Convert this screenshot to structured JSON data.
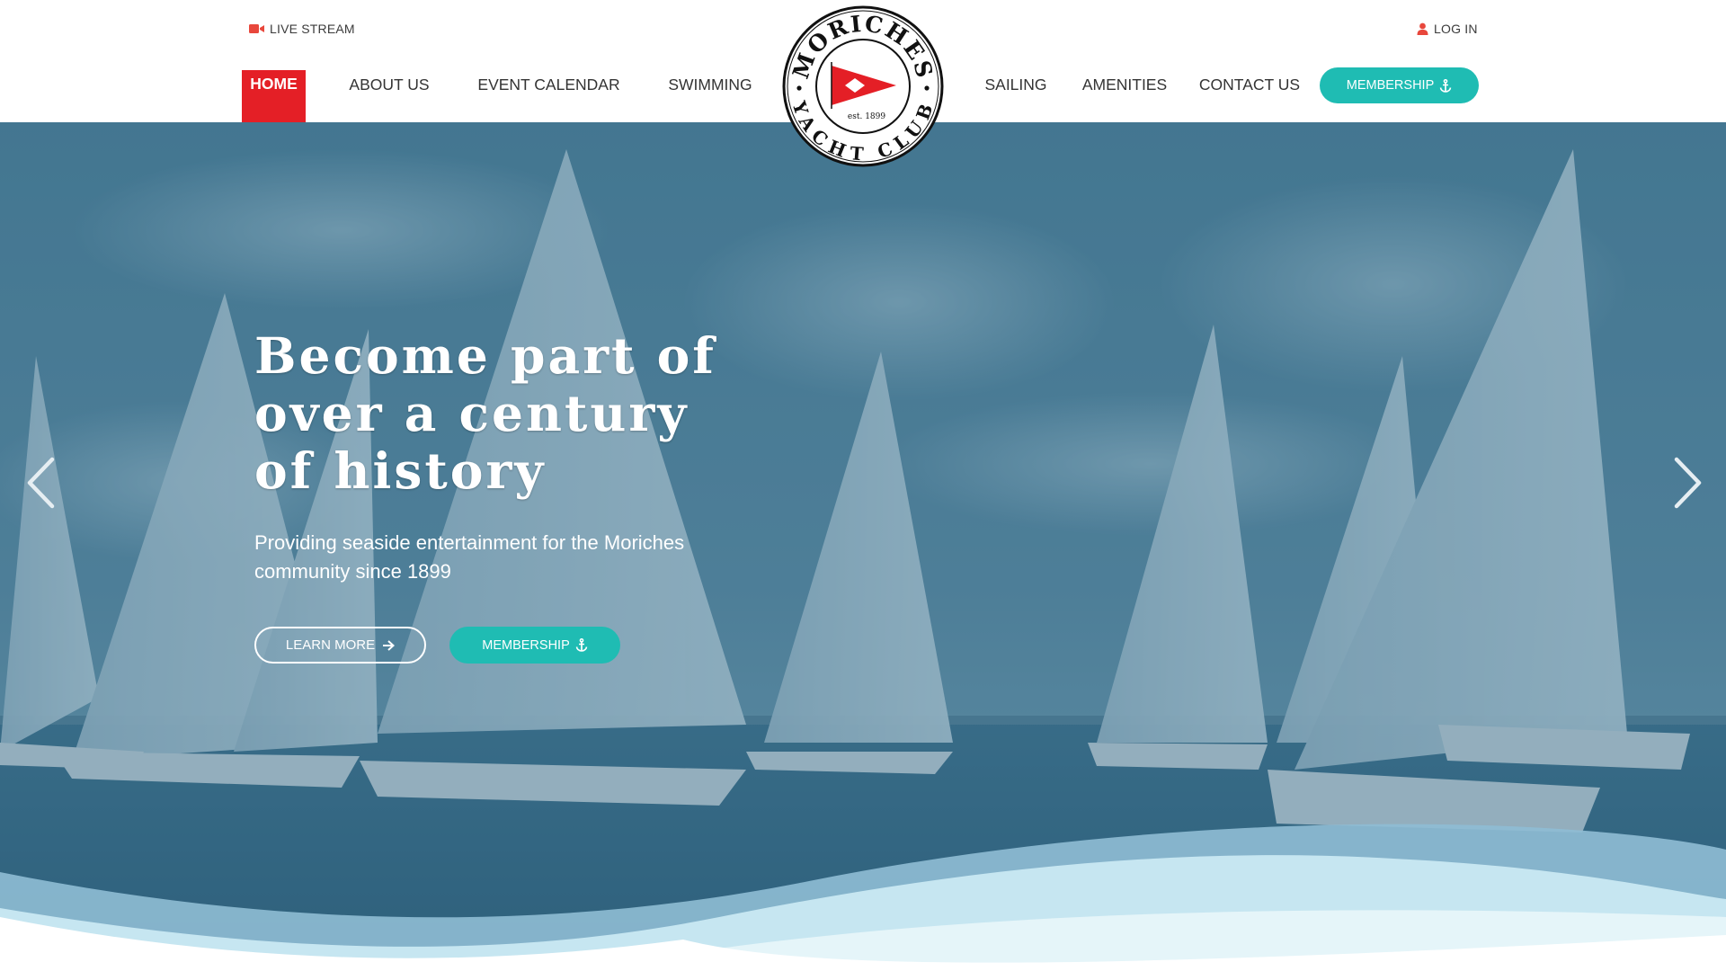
{
  "header": {
    "live_stream": {
      "label": "LIVE STREAM",
      "icon": "video-camera-icon",
      "icon_color": "#e8473c"
    },
    "log_in": {
      "label": "LOG IN",
      "icon": "user-icon",
      "icon_color": "#e8473c"
    },
    "nav": [
      {
        "label": "HOME",
        "active": true
      },
      {
        "label": "ABOUT US"
      },
      {
        "label": "EVENT CALENDAR"
      },
      {
        "label": "SWIMMING"
      },
      {
        "label": "SAILING"
      },
      {
        "label": "AMENITIES"
      },
      {
        "label": "CONTACT US"
      }
    ],
    "membership_button": {
      "label": "MEMBERSHIP",
      "icon": "anchor-icon"
    }
  },
  "logo": {
    "top_text": "MORICHES",
    "bottom_text": "YACHT CLUB",
    "est": "est. 1899",
    "flag": "red-pennant-burgee"
  },
  "hero": {
    "title_lines": [
      "Become part of",
      "over a century",
      "of history"
    ],
    "subtitle": "Providing seaside entertainment for the Moriches community since 1899",
    "learn_more": "LEARN MORE",
    "membership": "MEMBERSHIP",
    "prev_icon": "chevron-left-icon",
    "next_icon": "chevron-right-icon"
  },
  "colors": {
    "accent_red": "#e41f26",
    "teal": "#1fbcb3",
    "overlay": "#3e6f8a"
  }
}
